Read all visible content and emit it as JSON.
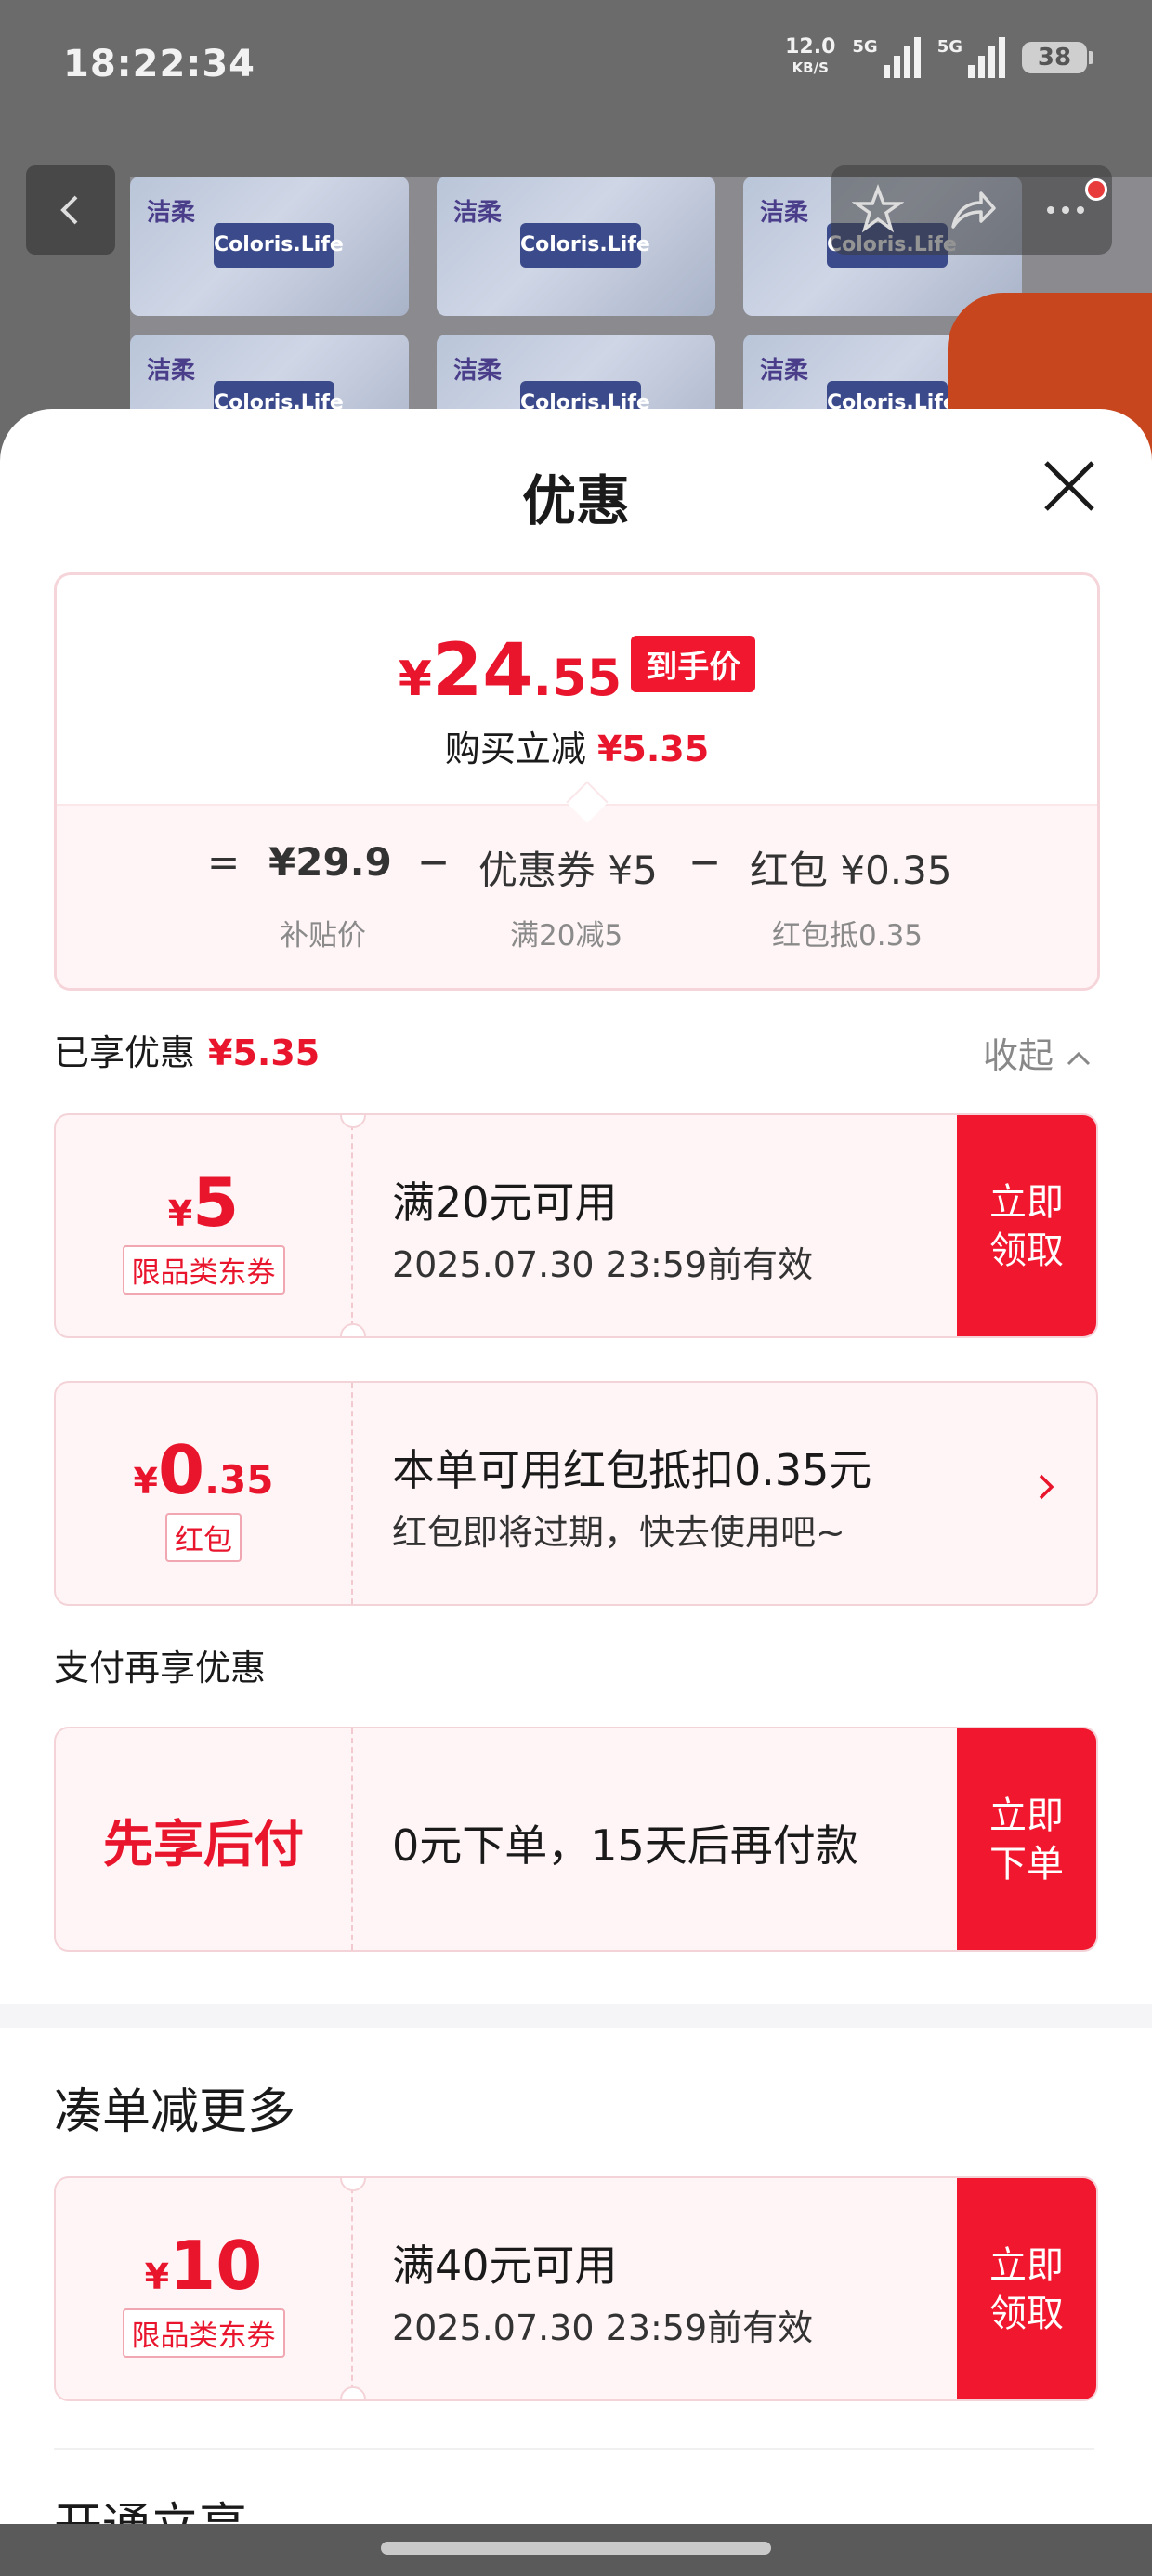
{
  "status_bar": {
    "time": "18:22:34",
    "net_speed": "12.0",
    "net_speed_unit": "KB/S",
    "signal1_label": "5G",
    "signal2_label": "5G",
    "battery": "38"
  },
  "background": {
    "brand_label": "Coloris.Life",
    "brand_glyph": "洁柔"
  },
  "sheet": {
    "title": "优惠"
  },
  "price_card": {
    "currency": "¥",
    "final_int": "24",
    "final_dec": ".55",
    "final_tag": "到手价",
    "reduce_label": "购买立减",
    "reduce_value": "¥5.35",
    "eq": "=",
    "subsidy_price": "¥29.9",
    "minus1": "−",
    "coupon_label": "优惠券 ¥5",
    "minus2": "−",
    "redpacket_label": "红包 ¥0.35",
    "cap_subsidy": "补贴价",
    "cap_coupon": "满20减5",
    "cap_redpacket": "红包抵0.35"
  },
  "enjoyed": {
    "label": "已享优惠",
    "value": "¥5.35",
    "collapse": "收起"
  },
  "coupon1": {
    "yen": "¥",
    "amount": "5",
    "tag": "限品类东券",
    "condition": "满20元可用",
    "expiry": "2025.07.30 23:59前有效",
    "button": "立即\n领取"
  },
  "redpacket": {
    "yen": "¥",
    "amount": "0",
    "dec": ".35",
    "tag": "红包",
    "line1": "本单可用红包抵扣0.35元",
    "line2": "红包即将过期，快去使用吧~"
  },
  "pay_section": {
    "label": "支付再享优惠",
    "left": "先享后付",
    "text": "0元下单，15天后再付款",
    "button": "立即\n下单"
  },
  "more_section": {
    "title": "凑单减更多"
  },
  "coupon2": {
    "yen": "¥",
    "amount": "10",
    "tag": "限品类东券",
    "condition": "满40元可用",
    "expiry": "2025.07.30 23:59前有效",
    "button": "立即\n领取"
  },
  "next_section": {
    "title": "开通立享"
  },
  "colors": {
    "accent_red": "#e8152d",
    "button_red": "#f0172e",
    "ticket_bg": "#fff5f6"
  }
}
